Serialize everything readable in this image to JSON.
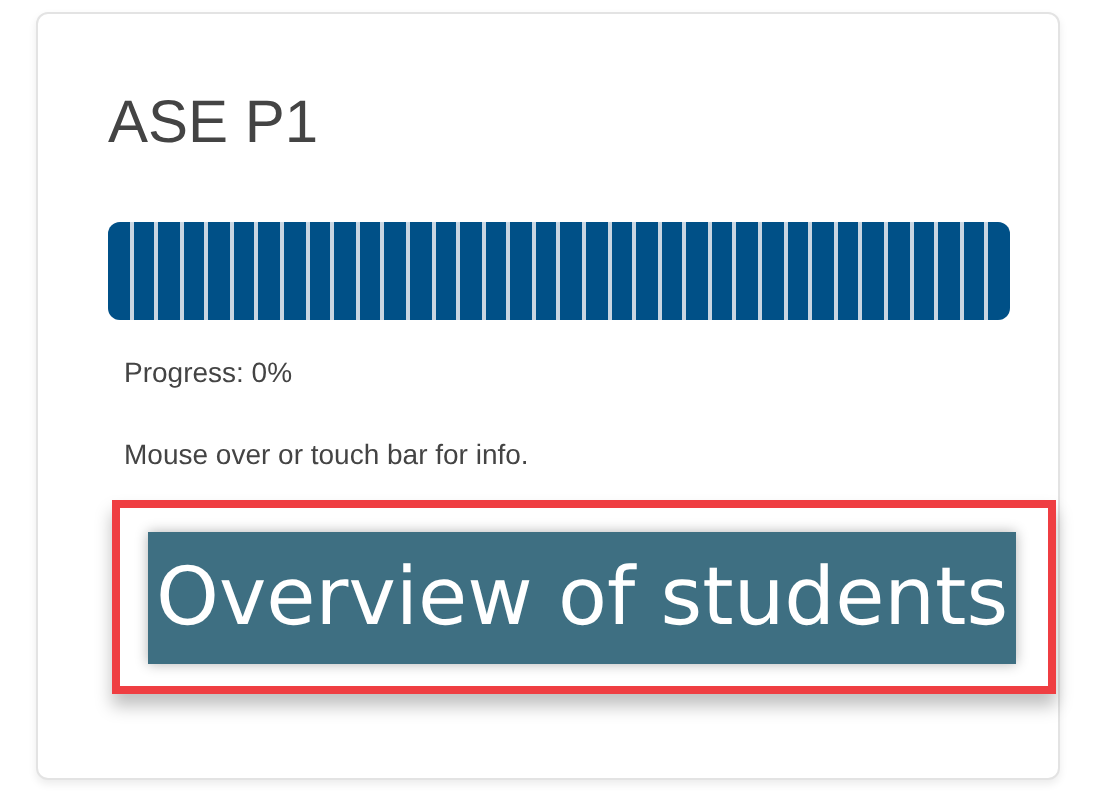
{
  "course": {
    "title": "ASE P1",
    "level": 0,
    "progress_text": "Progress: 0%",
    "hint": "Mouse over or touch bar for info.",
    "button": "Overview of students"
  }
}
